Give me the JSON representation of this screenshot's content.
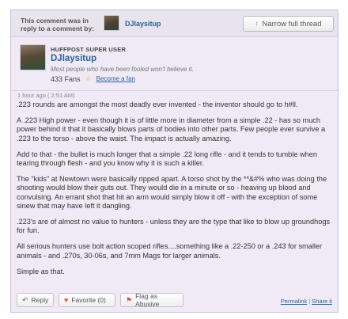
{
  "reply_bar": {
    "note": "This comment was in reply to a comment by:",
    "user": "DJlaysitup",
    "narrow_label": "Narrow full thread"
  },
  "author": {
    "badge": "HUFFPOST SUPER USER",
    "name": "DJlaysitup",
    "motto": "Most people who have been fooled won't believe it.",
    "fans": "433 Fans",
    "become_fan": "Become a fan"
  },
  "comment": {
    "time": "1 hour ago ( 2:51 AM)",
    "paragraphs": [
      ".223 rounds are amongst the most deadly ever invented - the inventor should go to h#ll.",
      "A .223 High power - even though it is of little more in diameter from a simple .22 - has so much power behind it that it basically blows parts of bodies into other parts. Few people ever survive a .223 to the torso - above the waist. The impact is actually amazing.",
      "Add to that - the bullet is much longer that a simple .22 long rifle - and it tends to tumble when tearing through flesh - and you know why it is such a killer.",
      "The \"kids\" at Newtown were basically ripped apart. A torso shot by the **&#% who was doing the shooting would blow their guts out. They would die in a minute or so - heaving up blood and convulsing. An errant shot that hit an arm would simply blow it off - with the exception of some sinew that may have left it dangling.",
      ".223's are of almost no value to hunters - unless they are the type that like to blow up groundhogs for fun.",
      "All serious hunters use bolt action scoped rifles....something like a .22-250 or a .243 for smaller animals - and .270s, 30-06s, and 7mm Mags for larger animals.",
      "Simple as that."
    ]
  },
  "actions": {
    "reply": "Reply",
    "favorite": "Favorite (0)",
    "flag": "Flag as Abusive",
    "permalink": "Permalink",
    "separator": "|",
    "share": "Share it"
  },
  "colors": {
    "link": "#2a6496",
    "panel_bg": "#efeaf5",
    "border": "#c9c2d8"
  }
}
